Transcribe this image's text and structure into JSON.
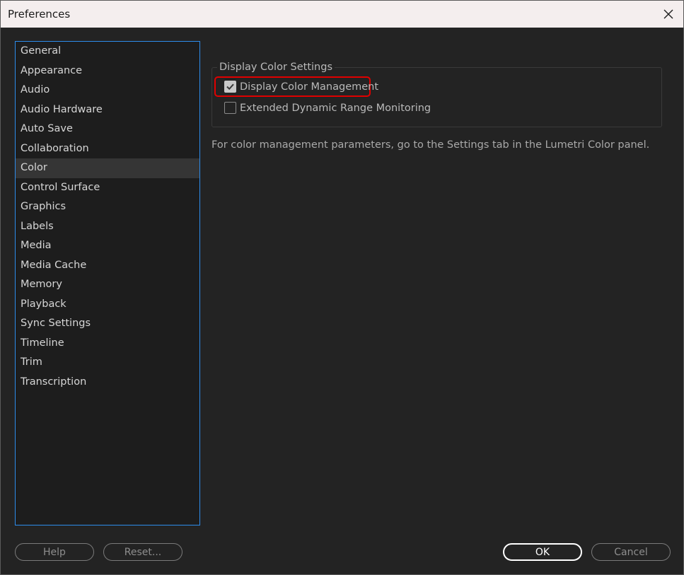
{
  "window": {
    "title": "Preferences"
  },
  "sidebar": {
    "items": [
      {
        "label": "General"
      },
      {
        "label": "Appearance"
      },
      {
        "label": "Audio"
      },
      {
        "label": "Audio Hardware"
      },
      {
        "label": "Auto Save"
      },
      {
        "label": "Collaboration"
      },
      {
        "label": "Color",
        "selected": true
      },
      {
        "label": "Control Surface"
      },
      {
        "label": "Graphics"
      },
      {
        "label": "Labels"
      },
      {
        "label": "Media"
      },
      {
        "label": "Media Cache"
      },
      {
        "label": "Memory"
      },
      {
        "label": "Playback"
      },
      {
        "label": "Sync Settings"
      },
      {
        "label": "Timeline"
      },
      {
        "label": "Trim"
      },
      {
        "label": "Transcription"
      }
    ]
  },
  "display_color_settings": {
    "title": "Display Color Settings",
    "display_color_management": {
      "label": "Display Color Management",
      "checked": true
    },
    "extended_dynamic_range": {
      "label": "Extended Dynamic Range Monitoring",
      "checked": false
    }
  },
  "info_text": "For color management parameters, go to the Settings tab in the Lumetri Color panel.",
  "buttons": {
    "help": "Help",
    "reset": "Reset...",
    "ok": "OK",
    "cancel": "Cancel"
  },
  "colors": {
    "accent": "#2d8ceb",
    "highlight": "#e00000",
    "background": "#232323"
  },
  "icons": [
    "close-icon",
    "checkmark-icon"
  ]
}
